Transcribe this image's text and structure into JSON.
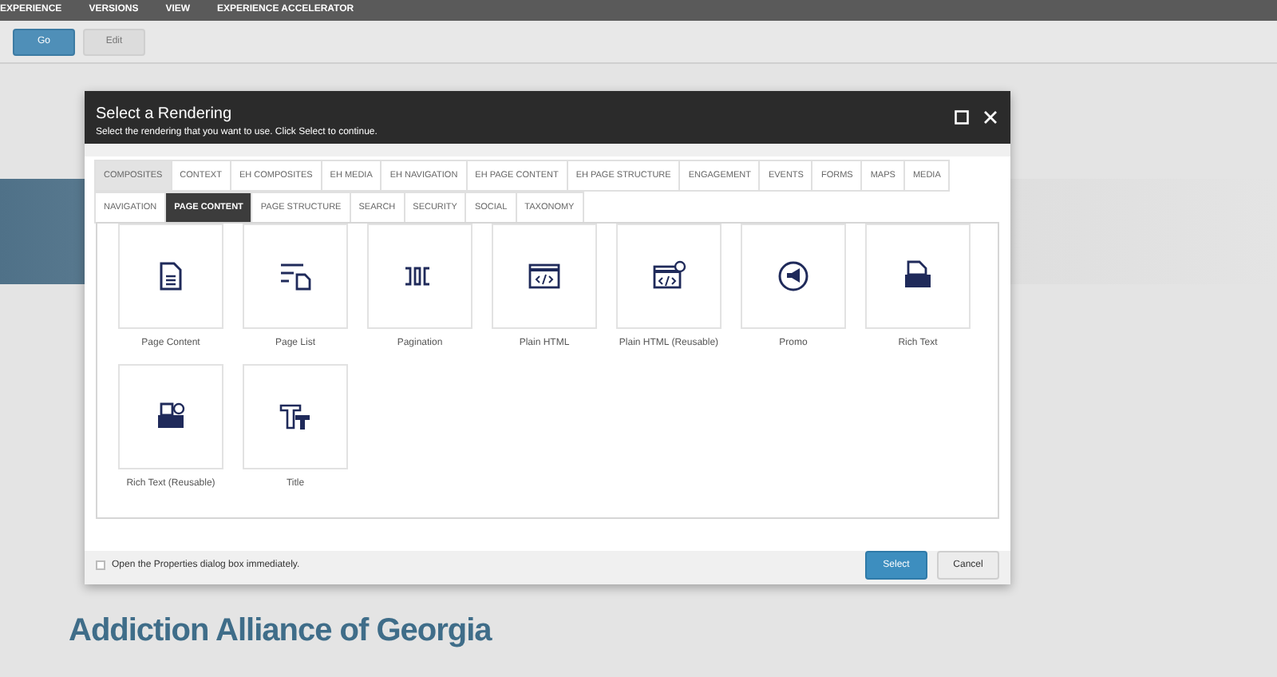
{
  "menu_bar": {
    "items": [
      "EXPERIENCE",
      "VERSIONS",
      "VIEW",
      "EXPERIENCE ACCELERATOR"
    ]
  },
  "toolbar": {
    "buttons": [
      {
        "label": "Go",
        "kind": "primary"
      },
      {
        "label": "Edit",
        "kind": "secondary"
      }
    ]
  },
  "dialog": {
    "title": "Select a Rendering",
    "subtitle": "Select the rendering that you want to use. Click Select to continue.",
    "tab_rows": [
      [
        {
          "label": "COMPOSITES",
          "selected": false,
          "hovered": true
        },
        {
          "label": "CONTEXT",
          "selected": false,
          "hovered": false
        },
        {
          "label": "EH COMPOSITES",
          "selected": false,
          "hovered": false
        },
        {
          "label": "EH MEDIA",
          "selected": false,
          "hovered": false
        },
        {
          "label": "EH NAVIGATION",
          "selected": false,
          "hovered": false
        },
        {
          "label": "EH PAGE CONTENT",
          "selected": false,
          "hovered": false
        },
        {
          "label": "EH PAGE STRUCTURE",
          "selected": false,
          "hovered": false
        },
        {
          "label": "ENGAGEMENT",
          "selected": false,
          "hovered": false
        },
        {
          "label": "EVENTS",
          "selected": false,
          "hovered": false
        },
        {
          "label": "FORMS",
          "selected": false,
          "hovered": false
        },
        {
          "label": "MAPS",
          "selected": false,
          "hovered": false
        },
        {
          "label": "MEDIA",
          "selected": false,
          "hovered": false
        }
      ],
      [
        {
          "label": "NAVIGATION",
          "selected": false,
          "hovered": false
        },
        {
          "label": "PAGE CONTENT",
          "selected": true,
          "hovered": false
        },
        {
          "label": "PAGE STRUCTURE",
          "selected": false,
          "hovered": false
        },
        {
          "label": "SEARCH",
          "selected": false,
          "hovered": false
        },
        {
          "label": "SECURITY",
          "selected": false,
          "hovered": false
        },
        {
          "label": "SOCIAL",
          "selected": false,
          "hovered": false
        },
        {
          "label": "TAXONOMY",
          "selected": false,
          "hovered": false
        }
      ]
    ],
    "renderings": [
      {
        "label": "Page Content",
        "kind": "document"
      },
      {
        "label": "Page List",
        "kind": "list"
      },
      {
        "label": "Pagination",
        "kind": "pagination"
      },
      {
        "label": "Plain HTML",
        "kind": "html"
      },
      {
        "label": "Plain HTML (Reusable)",
        "kind": "html-reusable"
      },
      {
        "label": "Promo",
        "kind": "promo"
      },
      {
        "label": "Rich Text",
        "kind": "rtf"
      },
      {
        "label": "Rich Text (Reusable)",
        "kind": "rtf-reusable"
      },
      {
        "label": "Title",
        "kind": "title"
      }
    ],
    "open_properties": {
      "label": "Open the Properties dialog box immediately.",
      "checked": false
    },
    "buttons": [
      {
        "label": "Select",
        "kind": "primary"
      },
      {
        "label": "Cancel",
        "kind": "secondary"
      }
    ]
  },
  "page_heading": "Addiction Alliance of Georgia"
}
